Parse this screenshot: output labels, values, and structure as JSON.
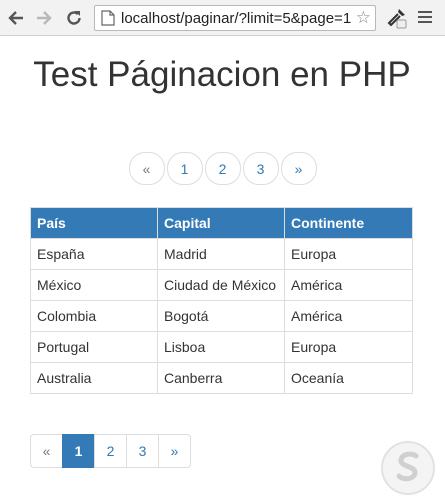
{
  "browser": {
    "url": "localhost/paginar/?limit=5&page=1",
    "icons": [
      "back-icon",
      "forward-icon",
      "reload-icon",
      "page-icon",
      "star-icon",
      "extension-icon",
      "menu-icon"
    ]
  },
  "page": {
    "title": "Test Páginacion en PHP",
    "pager_top": [
      "«",
      "1",
      "2",
      "3",
      "»"
    ],
    "table": {
      "headers": [
        "País",
        "Capital",
        "Continente"
      ],
      "rows": [
        [
          "España",
          "Madrid",
          "Europa"
        ],
        [
          "México",
          "Ciudad de México",
          "América"
        ],
        [
          "Colombia",
          "Bogotá",
          "América"
        ],
        [
          "Portugal",
          "Lisboa",
          "Europa"
        ],
        [
          "Australia",
          "Canberra",
          "Oceanía"
        ]
      ]
    },
    "pager_bottom": [
      "«",
      "1",
      "2",
      "3",
      "»"
    ],
    "active_page": "1",
    "colors": {
      "primary": "#337ab7",
      "border": "#dddddd"
    }
  }
}
